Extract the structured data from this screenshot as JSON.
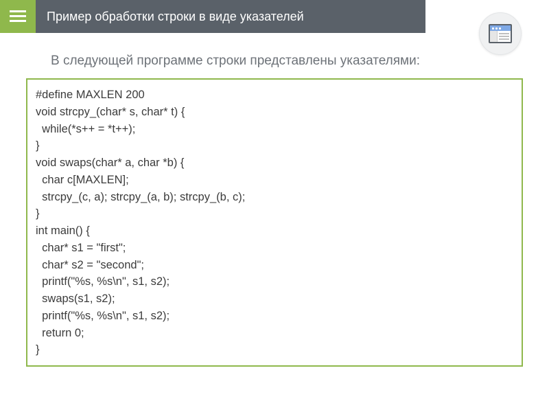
{
  "header": {
    "title": "Пример обработки строки в виде указателей"
  },
  "subtitle": "В следующей программе строки представлены указателями:",
  "code": {
    "lines": [
      "#define MAXLEN 200",
      "void strcpy_(char* s, char* t) {",
      "  while(*s++ = *t++);",
      "}",
      "void swaps(char* a, char *b) {",
      "  char c[MAXLEN];",
      "  strcpy_(c, a); strcpy_(a, b); strcpy_(b, c);",
      "}",
      "int main() {",
      "  char* s1 = \"first\";",
      "  char* s2 = \"second\";",
      "  printf(\"%s, %s\\n\", s1, s2);",
      "  swaps(s1, s2);",
      "  printf(\"%s, %s\\n\", s1, s2);",
      "  return 0;",
      "}"
    ]
  },
  "icons": {
    "menu": "hamburger-icon",
    "badge": "app-window-icon"
  }
}
